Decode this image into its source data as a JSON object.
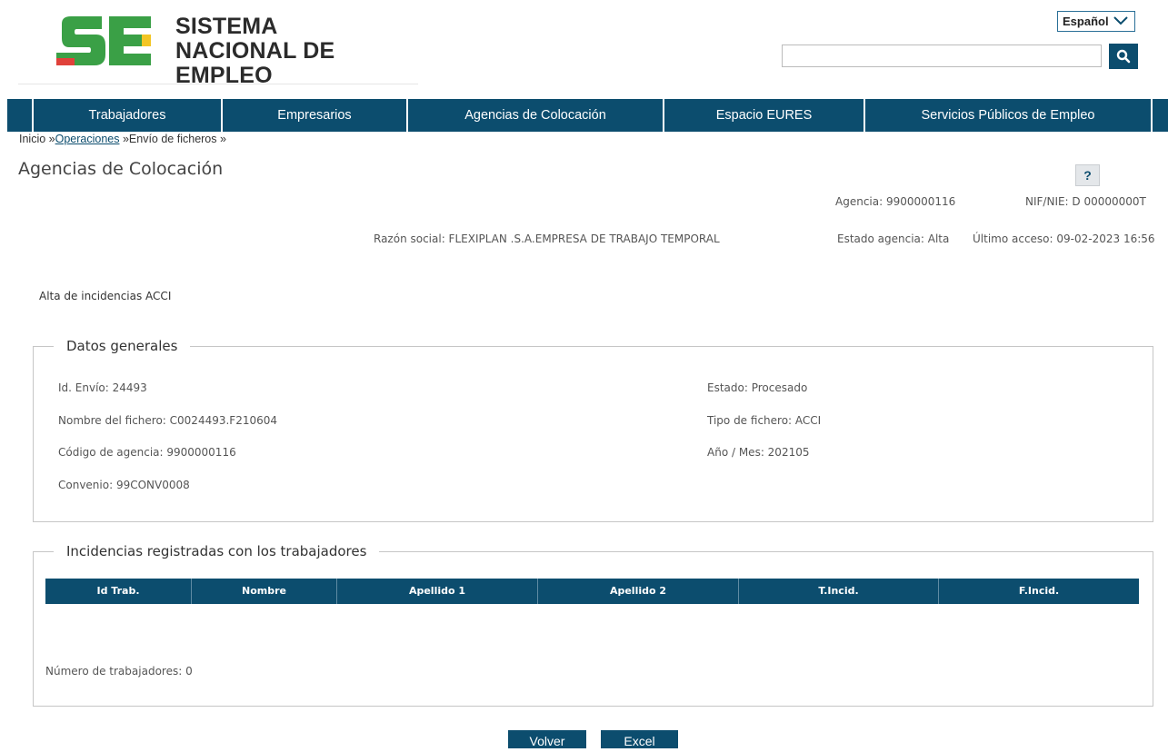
{
  "header": {
    "logo_line1": "SISTEMA",
    "logo_line2": "NACIONAL DE EMPLEO",
    "language": "Español",
    "search": {
      "value": "",
      "placeholder": ""
    }
  },
  "nav": [
    "Trabajadores",
    "Empresarios",
    "Agencias de Colocación",
    "Espacio EURES",
    "Servicios Públicos de Empleo"
  ],
  "breadcrumb": {
    "home": "Inicio »",
    "operaciones": "Operaciones",
    "sep": " »",
    "current": "Envío de ficheros »"
  },
  "page": {
    "title": "Agencias de Colocación",
    "help": "?",
    "agencia": "Agencia: 9900000116",
    "nif": "NIF/NIE: D 00000000T",
    "razon_social": "Razón social: FLEXIPLAN .S.A.EMPRESA DE TRABAJO TEMPORAL",
    "estado_agencia": "Estado agencia: Alta",
    "ultimo_acceso": "Último acceso: 09-02-2023 16:56",
    "section": "Alta de incidencias ACCI"
  },
  "datos_generales": {
    "legend": "Datos generales",
    "id_envio": "Id. Envío: 24493",
    "nombre_fichero": "Nombre del fichero: C0024493.F210604",
    "codigo_agencia": "Código de agencia: 9900000116",
    "convenio": "Convenio: 99CONV0008",
    "estado": "Estado: Procesado",
    "tipo_fichero": "Tipo de fichero: ACCI",
    "anio_mes": "Año / Mes: 202105"
  },
  "incidencias": {
    "legend": "Incidencias registradas con los trabajadores",
    "columns": [
      "Id Trab.",
      "Nombre",
      "Apellido 1",
      "Apellido 2",
      "T.Incid.",
      "F.Incid."
    ],
    "rows": [],
    "count_label": "Número de trabajadores: 0"
  },
  "buttons": {
    "volver": "Volver",
    "excel": "Excel"
  },
  "colors": {
    "primary": "#0c4d6e",
    "logo_green": "#3aa046",
    "logo_red": "#e0413a",
    "logo_yellow": "#f2c524"
  }
}
